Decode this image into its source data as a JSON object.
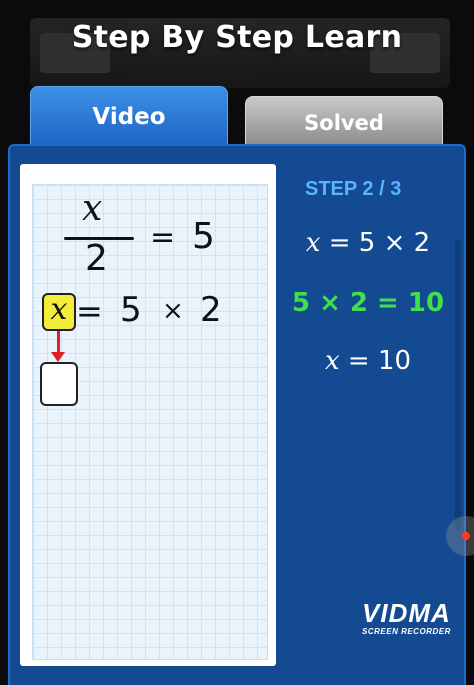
{
  "header": {
    "title": "Step By Step Learn"
  },
  "tabs": [
    {
      "label": "Video",
      "active": true
    },
    {
      "label": "Solved",
      "active": false
    }
  ],
  "board": {
    "fraction_numerator": "x",
    "fraction_denominator": "2",
    "equals": "=",
    "rhs": "5",
    "line2": {
      "var": "x",
      "equals": "=",
      "a": "5",
      "op": "×",
      "b": "2"
    }
  },
  "steps": {
    "label": "STEP 2 / 3",
    "lines": [
      {
        "var": "x",
        "rest": " = 5 × 2"
      },
      {
        "text": "5 × 2 = 10"
      },
      {
        "var": "x",
        "rest": " = 10"
      }
    ]
  },
  "watermark": {
    "logo": "VIDMA",
    "sub": "SCREEN RECORDER"
  },
  "colors": {
    "panel": "#134a91",
    "tab_active": "#2f7fd8",
    "step_label": "#5bb2ff",
    "highlight": "#f3ec3b",
    "result": "#3fe04a",
    "arrow": "#e02020"
  }
}
